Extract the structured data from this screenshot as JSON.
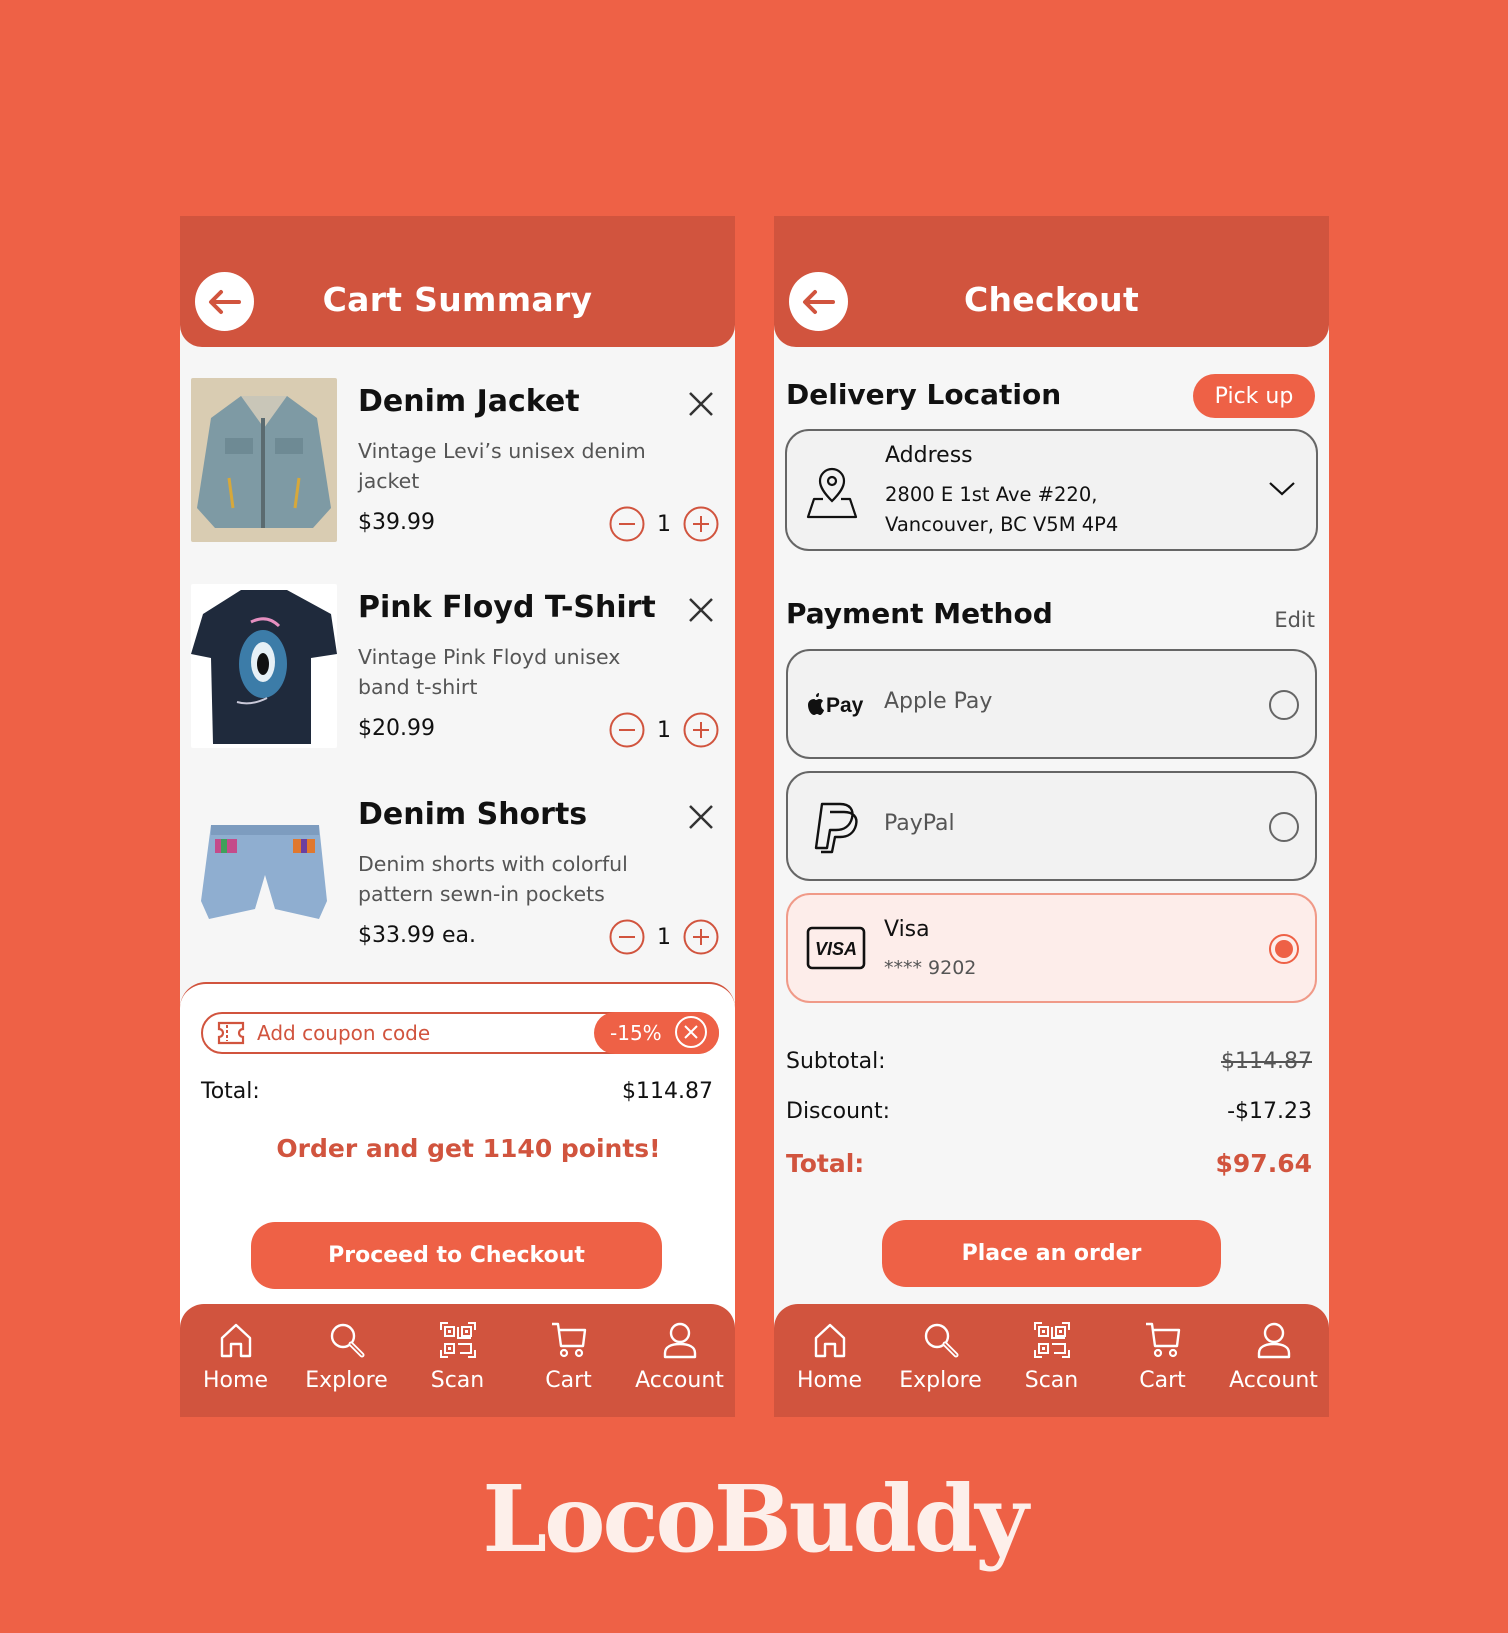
{
  "colors": {
    "background": "#EE6146",
    "header": "#D1543E",
    "accent": "#EE6146",
    "panel": "#F6F6F6",
    "selected_bg": "#FDEDEA"
  },
  "cart": {
    "title": "Cart Summary",
    "back_icon": "arrow-left-icon",
    "items": [
      {
        "name": "Denim Jacket",
        "description": "Vintage Levi’s unisex denim jacket",
        "price": "$39.99",
        "quantity": "1",
        "image": "denim-jacket-photo"
      },
      {
        "name": "Pink Floyd T-Shirt",
        "description": "Vintage Pink Floyd unisex band t-shirt",
        "price": "$20.99",
        "quantity": "1",
        "image": "pink-floyd-tshirt-photo"
      },
      {
        "name": "Denim Shorts",
        "description": "Denim shorts with colorful pattern sewn-in pockets",
        "price": "$33.99 ea.",
        "quantity": "1",
        "image": "denim-shorts-photo"
      }
    ],
    "coupon": {
      "placeholder": "Add coupon code",
      "applied": "-15%"
    },
    "total_label": "Total:",
    "total_value": "$114.87",
    "points_message": "Order and get 1140 points!",
    "cta": "Proceed to Checkout"
  },
  "checkout": {
    "title": "Checkout",
    "delivery_title": "Delivery Location",
    "pickup_label": "Pick up",
    "address": {
      "label": "Address",
      "line1": "2800 E 1st Ave #220,",
      "line2": "Vancouver, BC V5M 4P4"
    },
    "payment_title": "Payment Method",
    "edit_label": "Edit",
    "payment_options": [
      {
        "logo": " Pay",
        "name": "Apple Pay",
        "sub": "",
        "selected": false
      },
      {
        "logo": "PayPal",
        "name": "PayPal",
        "sub": "",
        "selected": false
      },
      {
        "logo": "VISA",
        "name": "Visa",
        "sub": "**** 9202",
        "selected": true
      }
    ],
    "subtotal_label": "Subtotal:",
    "subtotal_value": "$114.87",
    "discount_label": "Discount:",
    "discount_value": "-$17.23",
    "total_label": "Total:",
    "total_value": "$97.64",
    "cta": "Place an order"
  },
  "nav": [
    {
      "label": "Home",
      "icon": "home-icon"
    },
    {
      "label": "Explore",
      "icon": "search-icon"
    },
    {
      "label": "Scan",
      "icon": "qr-code-icon"
    },
    {
      "label": "Cart",
      "icon": "cart-icon"
    },
    {
      "label": "Account",
      "icon": "user-icon"
    }
  ],
  "brand": "LocoBuddy"
}
